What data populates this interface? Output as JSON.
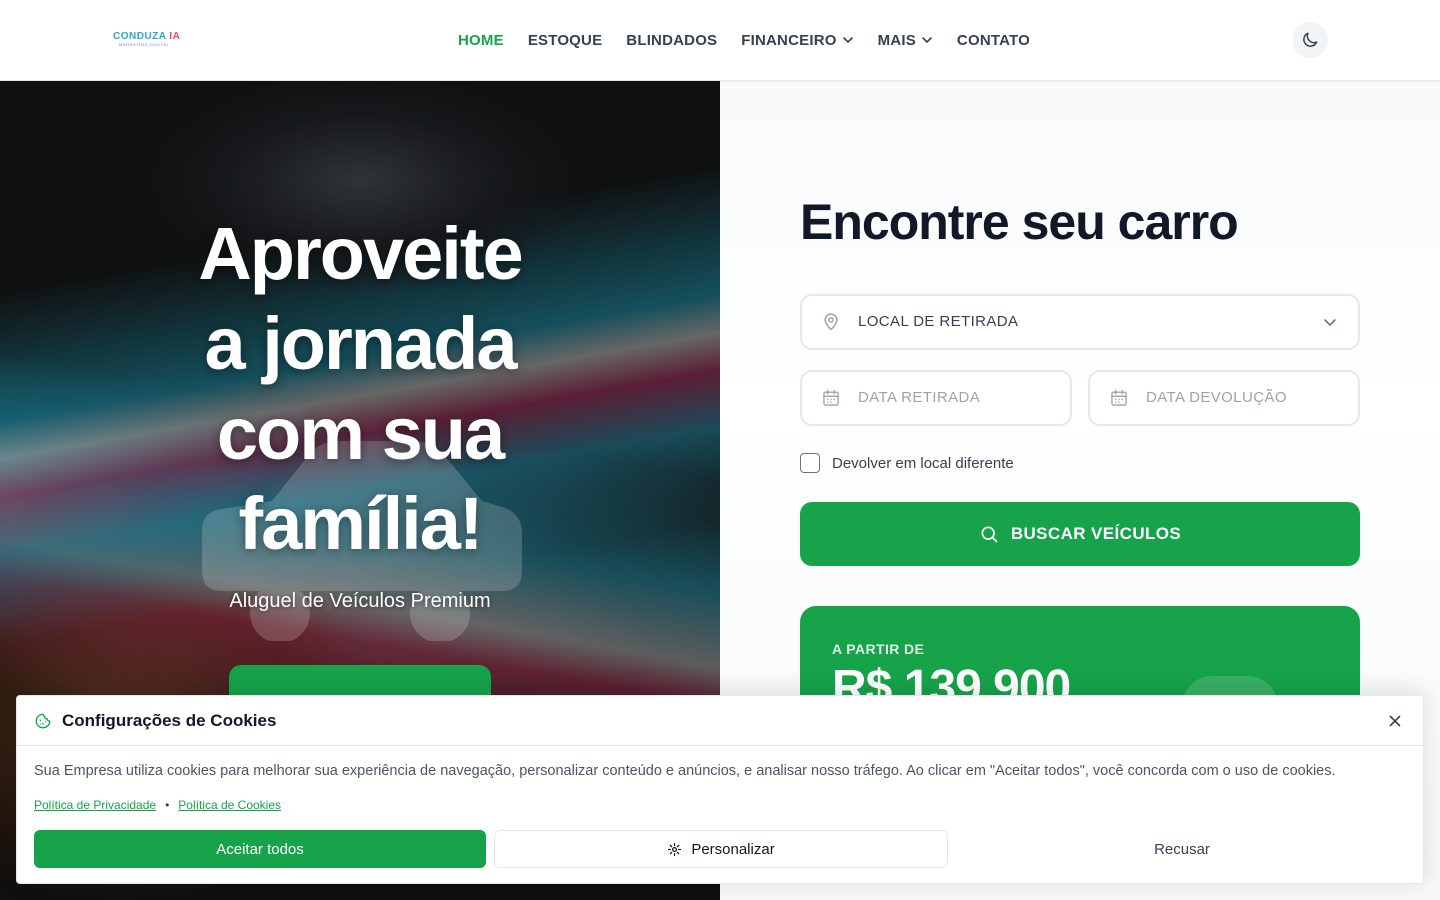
{
  "brand": {
    "logo_main_1": "CONDUZA",
    "logo_main_2": "IA",
    "logo_sub": "MARKETING DIGITAL"
  },
  "nav": {
    "items": [
      {
        "label": "HOME",
        "active": true
      },
      {
        "label": "ESTOQUE"
      },
      {
        "label": "BLINDADOS"
      },
      {
        "label": "FINANCEIRO",
        "dropdown": true
      },
      {
        "label": "MAIS",
        "dropdown": true
      },
      {
        "label": "CONTATO"
      }
    ],
    "theme_toggle_icon": "moon-icon"
  },
  "hero": {
    "title_lines": [
      "Aproveite",
      "a jornada",
      "com sua",
      "família!"
    ],
    "subtitle": "Aluguel de Veículos Premium"
  },
  "search": {
    "title": "Encontre seu carro",
    "location_label": "LOCAL DE RETIRADA",
    "pickup_placeholder": "DATA RETIRADA",
    "return_placeholder": "DATA DEVOLUÇÃO",
    "different_location_label": "Devolver em local diferente",
    "different_location_checked": false,
    "button_label": "BUSCAR VEÍCULOS"
  },
  "promo": {
    "kicker": "A PARTIR DE",
    "price": "R$ 139.900"
  },
  "cookie": {
    "title": "Configurações de Cookies",
    "text": "Sua Empresa utiliza cookies para melhorar sua experiência de navegação, personalizar conteúdo e anúncios, e analisar nosso tráfego. Ao clicar em \"Aceitar todos\", você concorda com o uso de cookies.",
    "privacy_link": "Política de Privacidade",
    "cookies_link": "Política de Cookies",
    "accept_label": "Aceitar todos",
    "customize_label": "Personalizar",
    "refuse_label": "Recusar"
  },
  "colors": {
    "accent": "#16a34a",
    "heading": "#111827",
    "nav_text": "#374151"
  }
}
